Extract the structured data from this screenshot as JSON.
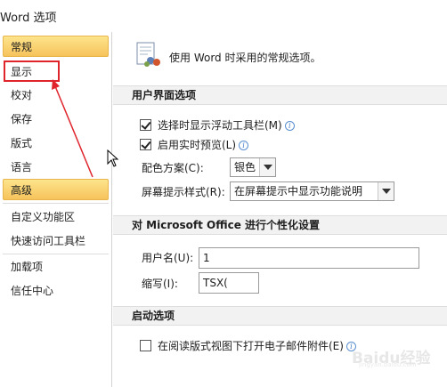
{
  "window": {
    "title": "Word 选项"
  },
  "sidebar": {
    "items": [
      {
        "label": "常规",
        "selected": true
      },
      {
        "label": "显示",
        "selected": false
      },
      {
        "label": "校对",
        "selected": false
      },
      {
        "label": "保存",
        "selected": false
      },
      {
        "label": "版式",
        "selected": false
      },
      {
        "label": "语言",
        "selected": false
      },
      {
        "label": "高级",
        "selected": true
      },
      {
        "label": "自定义功能区",
        "selected": false
      },
      {
        "label": "快速访问工具栏",
        "selected": false
      },
      {
        "label": "加载项",
        "selected": false
      },
      {
        "label": "信任中心",
        "selected": false
      }
    ]
  },
  "main": {
    "header": {
      "text": "使用 Word 时采用的常规选项。",
      "icon": "general-options-icon"
    },
    "ui_section": {
      "title": "用户界面选项",
      "show_minitoolbar": {
        "label": "选择时显示浮动工具栏(M)",
        "checked": true
      },
      "live_preview": {
        "label": "启用实时预览(L)",
        "checked": true
      },
      "color_scheme": {
        "label": "配色方案(C):",
        "value": "银色"
      },
      "screentip_style": {
        "label": "屏幕提示样式(R):",
        "value": "在屏幕提示中显示功能说明"
      }
    },
    "personalize_section": {
      "title": "对 Microsoft Office 进行个性化设置",
      "username": {
        "label": "用户名(U):",
        "value": "1"
      },
      "initials": {
        "label": "缩写(I):",
        "value": "TSX("
      }
    },
    "startup_section": {
      "title": "启动选项",
      "open_attachments": {
        "label": "在阅读版式视图下打开电子邮件附件(E)",
        "checked": false
      }
    }
  },
  "annotation": {
    "color": "#e0242c"
  },
  "watermark": {
    "text": "Baidu经验",
    "sub": "jingyan.baidu.com"
  },
  "colors": {
    "selected_nav": "#f6c35b",
    "section_bg": "#f2f2f2",
    "info_icon": "#3d78c8"
  }
}
